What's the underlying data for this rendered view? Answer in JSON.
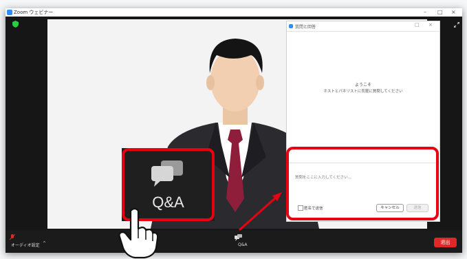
{
  "window": {
    "title": "Zoom ウェビナー"
  },
  "panel": {
    "title": "質問と回答",
    "welcome_title": "ようこそ",
    "welcome_text": "ホストとパネリストに気軽に質問してください",
    "input_placeholder": "質問をここに入力してください...",
    "anonymous_label": "匿名で送信",
    "cancel_label": "キャンセル",
    "send_label": "送信"
  },
  "toolbar": {
    "audio_label": "オーディオ設定",
    "qa_label": "Q&A",
    "end_label": "退出"
  },
  "callout": {
    "qa_label": "Q&A"
  },
  "colors": {
    "accent_red": "#e60012",
    "zoom_blue": "#2d8cff",
    "end_red": "#e02828"
  }
}
